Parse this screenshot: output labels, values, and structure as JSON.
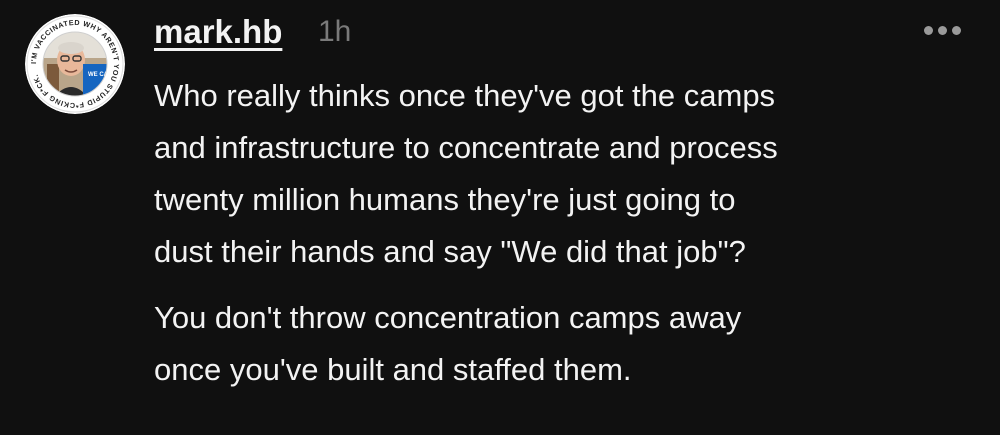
{
  "post": {
    "author": "mark.hb",
    "timestamp": "1h",
    "avatar": {
      "ring_text": "I'M VACCINATED WHY AREN'T YOU STUPID F*CKING F*CK.",
      "badge_text": "WE CAN",
      "ring_color": "#ffffff",
      "badge_color": "#1565c0"
    },
    "more_icon": "ellipsis-icon",
    "paragraphs": [
      "Who really thinks once they've got the camps\nand infrastructure to concentrate and process\ntwenty million humans they're just going to\ndust their hands and say \"We did that job\"?",
      "You don't throw concentration camps away\nonce you've built and staffed them."
    ]
  },
  "colors": {
    "background": "#101010",
    "text": "#f3f3f3",
    "muted": "#7a7a7a",
    "icon": "#9a9a9a"
  }
}
